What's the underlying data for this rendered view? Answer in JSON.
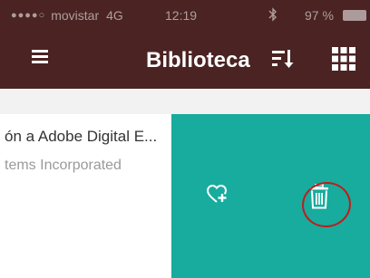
{
  "status_bar": {
    "carrier": "movistar",
    "network": "4G",
    "time": "12:19",
    "battery": "97 %",
    "bluetooth_icon": "bluetooth-icon"
  },
  "nav": {
    "title": "Biblioteca",
    "menu_icon": "hamburger-menu-icon",
    "sort_icon": "sort-icon",
    "grid_icon": "grid-view-icon"
  },
  "item": {
    "title": "ón a Adobe Digital E...",
    "author": "tems Incorporated"
  },
  "actions": {
    "favorite_icon": "add-to-favorites-heart-icon",
    "delete_icon": "trash-icon"
  },
  "colors": {
    "navbar_bg": "#4b2323",
    "action_bg": "#17ac9d",
    "annotation": "#c41a1a"
  }
}
